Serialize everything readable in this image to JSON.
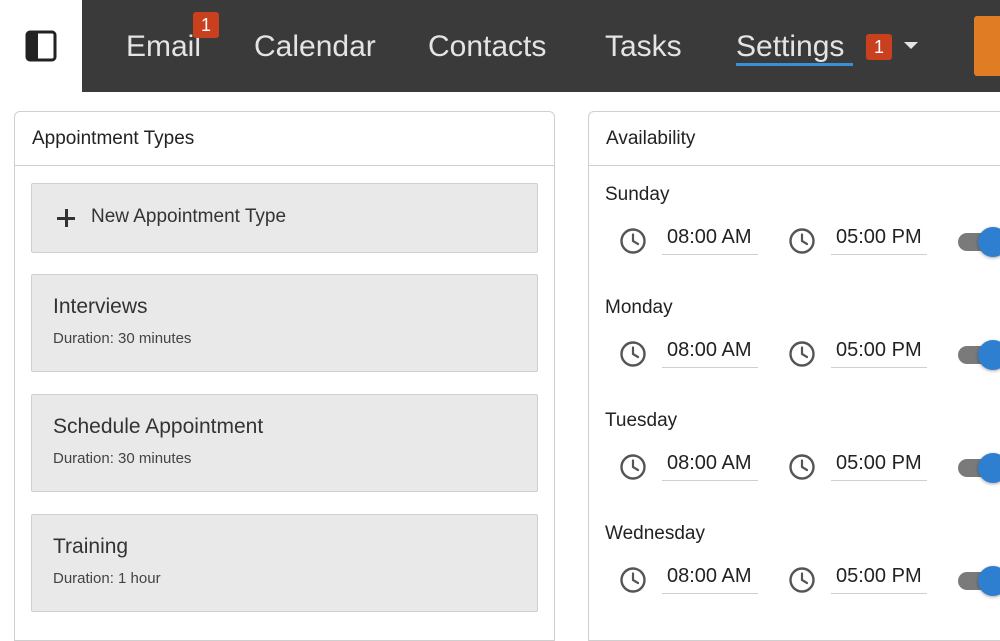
{
  "nav": {
    "items": [
      {
        "label": "Email",
        "badge": "1"
      },
      {
        "label": "Calendar"
      },
      {
        "label": "Contacts"
      },
      {
        "label": "Tasks"
      },
      {
        "label": "Settings",
        "badge": "1",
        "active": true
      }
    ],
    "accent_color": "#3a8fd9",
    "badge_color": "#c9401e",
    "action_color": "#e07c24"
  },
  "appointment_types": {
    "title": "Appointment Types",
    "new_label": "New Appointment Type",
    "items": [
      {
        "name": "Interviews",
        "duration": "Duration: 30 minutes"
      },
      {
        "name": "Schedule Appointment",
        "duration": "Duration: 30 minutes"
      },
      {
        "name": "Training",
        "duration": "Duration: 1 hour"
      }
    ]
  },
  "availability": {
    "title": "Availability",
    "days": [
      {
        "day": "Sunday",
        "start": "08:00 AM",
        "end": "05:00 PM",
        "enabled": true
      },
      {
        "day": "Monday",
        "start": "08:00 AM",
        "end": "05:00 PM",
        "enabled": true
      },
      {
        "day": "Tuesday",
        "start": "08:00 AM",
        "end": "05:00 PM",
        "enabled": true
      },
      {
        "day": "Wednesday",
        "start": "08:00 AM",
        "end": "05:00 PM",
        "enabled": true
      }
    ]
  }
}
